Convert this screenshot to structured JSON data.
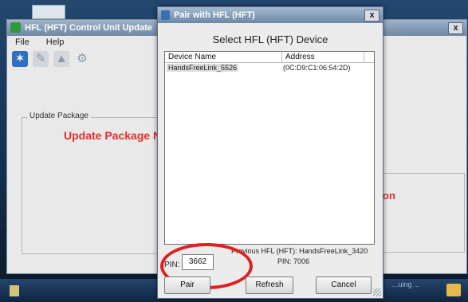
{
  "main_window": {
    "title": "HFL (HFT) Control Unit Update",
    "close_glyph": "x",
    "menu": [
      "File",
      "Help"
    ],
    "update_package_label": "Update Package",
    "status_text": "Update Package Not",
    "right_status_fragment": "on"
  },
  "taskbar": {
    "tray_text": "...uing ..."
  },
  "dialog": {
    "title": "Pair with HFL (HFT)",
    "close_glyph": "x",
    "heading": "Select HFL (HFT) Device",
    "columns": {
      "name": "Device Name",
      "address": "Address"
    },
    "devices": [
      {
        "name": "HandsFreeLink_5526",
        "address": "(0C:D9:C1:06:54:2D)"
      }
    ],
    "pin_label": "PIN:",
    "pin_value": "3662",
    "previous_label": "Previous HFL (HFT): HandsFreeLink_3420",
    "previous_pin": "PIN: 7006",
    "buttons": {
      "pair": "Pair",
      "refresh": "Refresh",
      "cancel": "Cancel"
    }
  },
  "colors": {
    "status_red": "#e32d2d",
    "annotation_circle": "#e02020"
  }
}
